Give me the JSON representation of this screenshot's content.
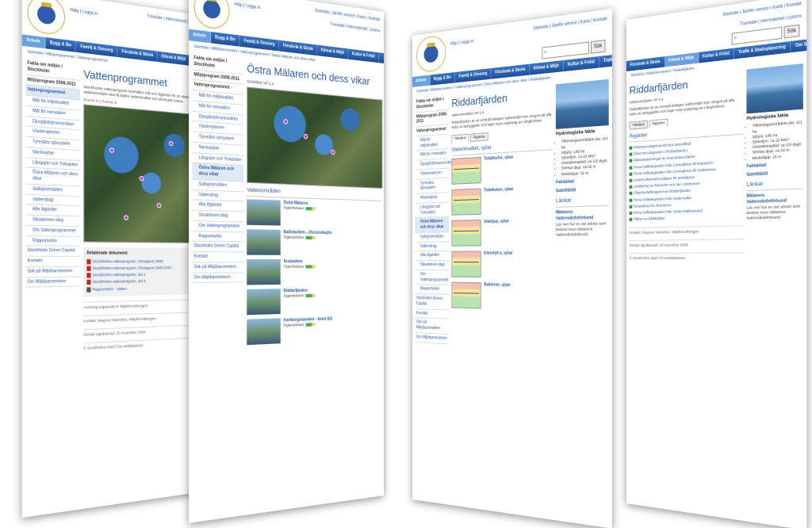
{
  "common": {
    "login": "Hälp | Logga in",
    "toplinks": "Startsida | Jämför service | Karta | Kontakt",
    "sublinks": "Translate | International | Lyssna",
    "search_btn": "Sök",
    "nav": [
      "Arbete",
      "Bygg & Bo",
      "Familj & Omsorg",
      "Förskola & Skola",
      "Klimat & Miljö",
      "Kultur & Fritid",
      "Trafik & Stadsplanering",
      "Om Stockholm"
    ]
  },
  "page1": {
    "crumb": "Startsida / Miljöprogrammet / Vattenprogrammet",
    "title": "Vattenprogrammet",
    "intro": "Stockholms vattenprogram innehåller mål och åtgärder för en stadens vattenområden ska få bättre vattenkvalitet och ekologisk status.",
    "side": [
      "Fakta om miljön i Stockholm",
      "Miljöprogram 2008-2011",
      "Vattenprogrammet",
      "Mål för miljökvalitet",
      "Mål för reinvation",
      "Djurgårdsbrunnsviken",
      "Västeroptoren",
      "Tyresåns sjösystem",
      "Nackasjöar",
      "Långsjön och Trekanten",
      "Östra Mälaren och dess vikar",
      "Saltsjöområden",
      "Vattendrag",
      "Alla åtgärder",
      "Situationen idag",
      "Om Vattenprogrammet",
      "Rapportarkiv",
      "Stockholm Green Capital",
      "Kontakt",
      "Sök på Miljöbarometern",
      "Om Miljöbarometern"
    ],
    "map_bar": "Zooma in | Zooma ut",
    "related_title": "Relaterade dokument",
    "docs": [
      "Stockholms vattenprogram, Årsrapport 2008",
      "Stockholms vattenprogram, Årsrapport 2006-2007",
      "Stockholms vattenprogram, del 1",
      "Stockholms vattenprogram, del 2",
      "Rapportarkiv - Vatten"
    ],
    "owner": "Ansvarig organisation: Miljöförvaltningen",
    "contact": "Kontakt: Magnus Sannebro, Miljöförvaltningen",
    "updated": "Senast uppdaterad: 20 november 2009",
    "footer": "© Stockholms stad | Om webbplatsen"
  },
  "page2": {
    "crumb": "Startsida / Miljöbarometern / Vattenprogrammet / Östra Mälaren och dess vikar",
    "title": "Östra Mälaren och dess vikar",
    "sub": "Områdets VP 2.4",
    "section": "Vattenområden",
    "areas": [
      "Östra Mälaren",
      "Ballstaviken - Ulvsundasjön",
      "Årstaviken",
      "Riddarfjärden",
      "Karlbergskanalen - klara Sjö"
    ],
    "status": "Åtgärdsstatus",
    "side": [
      "Fakta om miljön i Stockholm",
      "Miljöprogram 2008-2011",
      "Vattenprogrammet",
      "Mål för miljökvalitet",
      "Mål för reinvation",
      "Djurgårdsbrunnsviken",
      "Västeroptoren",
      "Tyresåns sjösystem",
      "Nackasjöar",
      "Långsjön och Trekanten",
      "Östra Mälaren och dess vikar",
      "Saltsjöområden",
      "Vattendrag",
      "Alla åtgärder",
      "Situationen idag",
      "Om Vattenprogrammet",
      "Rapportarkiv",
      "Stockholm Green Capital",
      "Kontakt",
      "Sök på Miljöbarometern",
      "Om Miljöbarometern"
    ]
  },
  "page3": {
    "crumb": "Startsida / Miljöbarometern / Vattenprogrammet / Östra Mälaren och dess vikar / Riddarfjärden",
    "title": "Riddarfjärden",
    "sub": "Vattenområden VP 2.4",
    "intro": "Riddarfjärden är en centralt belägen vattenmiljö som omges på alla sidor av bebyggelse och kajer med undantag av Långholmen.",
    "tabs": [
      "Tillstånd",
      "Åtgärder"
    ],
    "section": "Vattenkvalitet, sjöar",
    "indicators": [
      "Totalfosfor, sjöar",
      "Totalkväve, sjöar",
      "Siktdjup, sjöar",
      "Klorofyll a, sjöar",
      "Bakterier, sjöar"
    ],
    "facts_title": "Hydrologiska fakta",
    "facts": [
      "Tillrinningsområdets yta: 111 ha",
      "Sjöyta: 145 ha",
      "Sjövolym: ca 22 Mm³",
      "Omsättningstid: ca 1/3 dygn",
      "Största djup: ca 22 m",
      "Medeldjup: 15 m"
    ],
    "links": [
      "Faktablad",
      "Satellitbild"
    ],
    "links_title": "Länkar",
    "link": "Mälarens Vattenvårdsförbund",
    "link_desc": "Läs mer hur en det arbete som bedrivs inom Mälarens Vattenvårdsförbund.",
    "side": [
      "Fakta om miljön i Stockholm",
      "Miljöprogram 2008-2011",
      "Vattenprogrammet",
      "Mål för miljökvalitet",
      "Mål för reinvation",
      "Djurgårdsbrunnsviken",
      "Västeroptoren",
      "Tyresåns sjösystem",
      "Nackasjöar",
      "Långsjön och Trekanten",
      "Östra Mälaren och dess vikar",
      "Saltsjöområden",
      "Vattendrag",
      "Alla åtgärder",
      "Situationen idag",
      "Om Vattenprogrammet",
      "Rapportarkiv",
      "Stockholm Green Capital",
      "Kontakt",
      "Sök på Miljöbarometern",
      "Om Miljöbarometern"
    ]
  },
  "page4": {
    "crumb": "Startsida / Miljöbarometern / Riddarfjärden",
    "title": "Riddarfjärden",
    "sub": "Vattenområden VP 2.4",
    "intro": "Riddarfjärden är en centralt belägen vattenmiljö som omges på alla sidor av bebyggelse och kajer med undantag av Långholmen.",
    "tabs": [
      "Tillstånd",
      "Åtgärder"
    ],
    "section": "Åtgärder",
    "actions": [
      "Bottenprovtagning vid nya strandblad",
      "Ökat rent dagvatten i Riddarfjärden",
      "Miljöanpassningar av strandnära platser",
      "Rena trafikdagvatten från Centralbron till Norrström",
      "Rena trafikdagvatten från Centralbron till Söderström",
      "Utreda alternativa platser för snödeponi",
      "Utsättning av fisksorter och lax i Strömmen",
      "Fågel/avfallsrapport av Riddarfjärden",
      "Rena trafikdagvatten från Södermälar",
      "Strandstad för Norrström",
      "Rena trafikdagvatten från Söder Mälarstrand",
      "Tillsyn av båtklubbar"
    ],
    "facts_title": "Hydrologiska fakta",
    "facts": [
      "Tillrinningsområdets yta: 111 ha",
      "Sjöyta: 145 ha",
      "Sjövolym: ca 22 Mm³",
      "Omsättningstid: ca 1/3 dygn",
      "Största djup: ca 22 m",
      "Medeldjup: 15 m"
    ],
    "links": [
      "Faktablad",
      "Satellitbild"
    ],
    "links_title": "Länkar",
    "link": "Mälarens Vattenvårdsförbund",
    "link_desc": "Läs mer hur en det arbete som bedrivs inom Mälarens Vattenvårdsförbund.",
    "contact": "Kontakt: Magnus Sannebro, Miljöförvaltningen",
    "updated": "Senast uppdaterad: 19 november 2009",
    "footer": "© Stockholms stad | Om webbplatsen"
  }
}
